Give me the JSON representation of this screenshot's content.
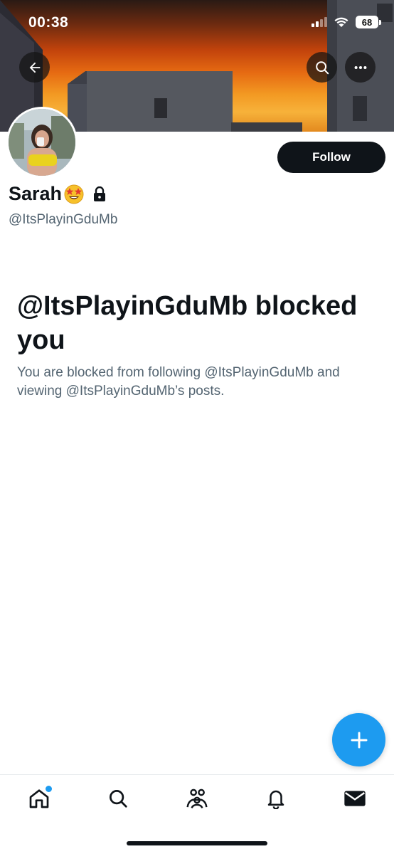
{
  "status_bar": {
    "time": "00:38",
    "battery": "68"
  },
  "profile": {
    "display_name": "Sarah",
    "handle": "@ItsPlayinGduMb",
    "follow_label": "Follow"
  },
  "blocked": {
    "title": "@ItsPlayinGduMb blocked you",
    "description": "You are blocked from following @ItsPlayinGduMb and viewing @ItsPlayinGduMb’s posts."
  },
  "icons": {
    "back": "back-arrow-icon",
    "search": "search-icon",
    "more": "more-icon",
    "emoji": "star-struck-emoji-icon",
    "lock": "lock-icon",
    "compose": "plus-icon",
    "nav": [
      "home-icon",
      "search-icon",
      "communities-icon",
      "notifications-icon",
      "messages-icon"
    ]
  },
  "colors": {
    "accent": "#1d9bf0",
    "text": "#0f1419",
    "secondary": "#536471"
  }
}
